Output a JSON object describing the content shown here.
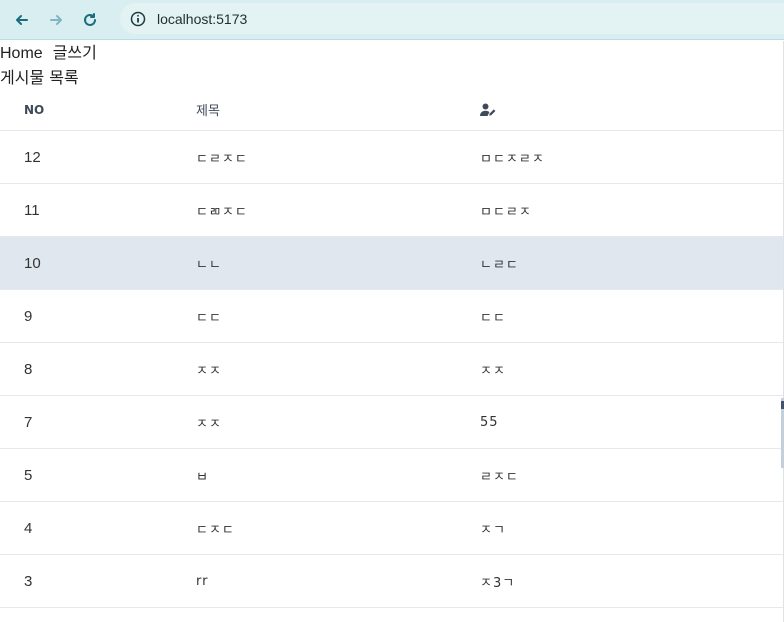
{
  "browser": {
    "url": "localhost:5173"
  },
  "nav": {
    "home": "Home",
    "write": "글쓰기"
  },
  "board": {
    "title": "게시물 목록",
    "header": {
      "no": "NO",
      "title": "제목",
      "author_icon": "user-edit-icon"
    },
    "rows": [
      {
        "no": "12",
        "title": "ㄷㄹㅈㄷ",
        "author": "ㅁㄷㅈㄹㅈ"
      },
      {
        "no": "11",
        "title": "ㄷㄻㅈㄷ",
        "author": "ㅁㄷㄹㅈ"
      },
      {
        "no": "10",
        "title": "ㄴㄴ",
        "author": "ㄴㄹㄷ"
      },
      {
        "no": "9",
        "title": "ㄷㄷ",
        "author": "ㄷㄷ"
      },
      {
        "no": "8",
        "title": "ㅈㅈ",
        "author": "ㅈㅈ"
      },
      {
        "no": "7",
        "title": "ㅈㅈ",
        "author": "55"
      },
      {
        "no": "5",
        "title": "ㅂ",
        "author": "ㄹㅈㄷ"
      },
      {
        "no": "4",
        "title": "ㄷㅈㄷ",
        "author": "ㅈㄱ"
      },
      {
        "no": "3",
        "title": "rr",
        "author": "ㅈ3ㄱ"
      }
    ]
  },
  "colors": {
    "selected_row": "#e0e7ef",
    "browser_bar": "#d9eef0"
  }
}
